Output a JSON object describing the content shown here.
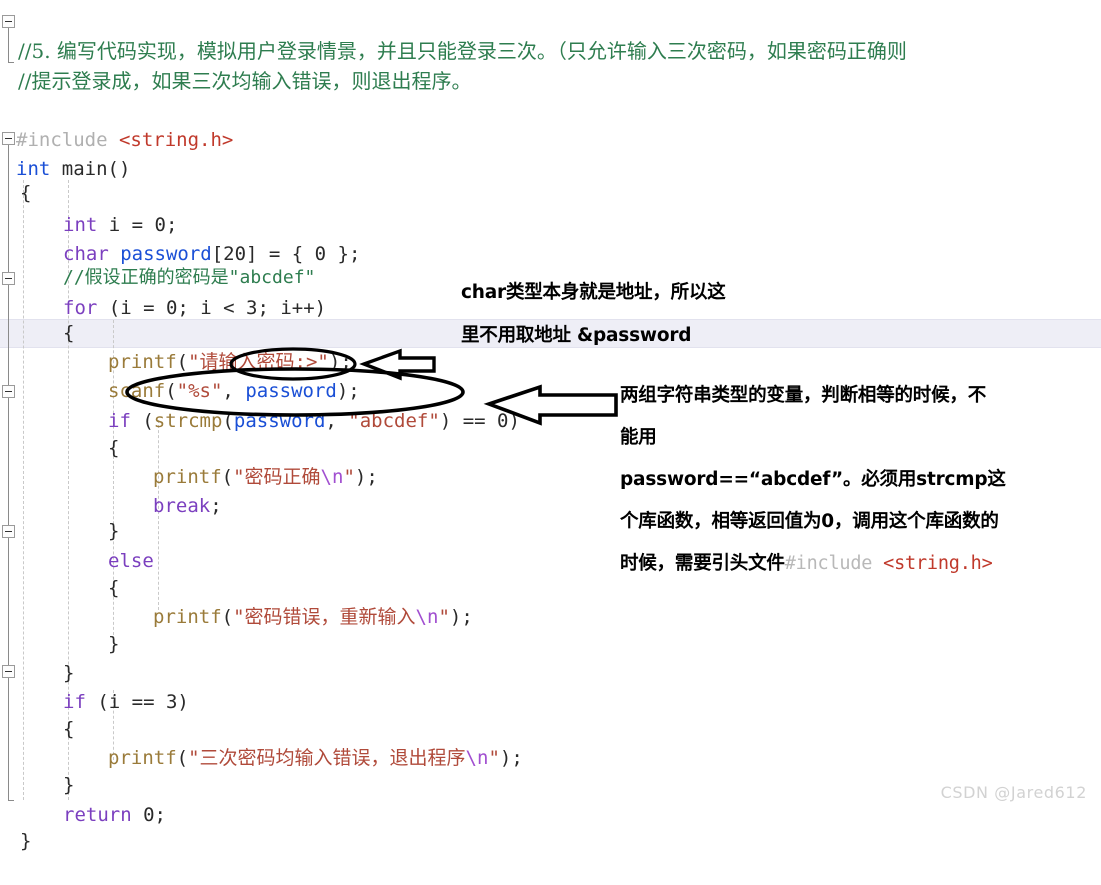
{
  "editor": {
    "top_comments": [
      "//5. 编写代码实现，模拟用户登录情景，并且只能登录三次。（只允许输入三次密码，如果密码正确则",
      "//提示登录成，如果三次均输入错误，则退出程序。"
    ],
    "lines": {
      "include_directive": "#include",
      "include_file": "<string.h>",
      "main_sig_kw": "int",
      "main_sig_name": "main",
      "main_sig_parens": "()",
      "brace_open": "{",
      "brace_close": "}",
      "decl_int_kw": "int",
      "decl_int_rest": " i = 0;",
      "decl_char_kw": "char",
      "decl_char_name": " password",
      "decl_char_rest": "[20] = { 0 };",
      "comment_pwd": "//假设正确的密码是\"abcdef\"",
      "for_kw": "for",
      "for_rest": " (i = 0; i < 3; i++)",
      "printf_name": "printf",
      "printf_prompt_str": "\"请输入密码:>\"",
      "scanf_name": "scanf",
      "scanf_fmt": "\"%s\"",
      "scanf_arg": "password",
      "if_kw": "if",
      "strcmp_name": "strcmp",
      "strcmp_arg1": "password",
      "strcmp_arg2": "\"abcdef\"",
      "strcmp_cmp": " == 0)",
      "printf_ok_str": "\"密码正确",
      "printf_ok_esc": "\\n",
      "break_kw": "break",
      "else_kw": "else",
      "printf_err_str": "\"密码错误，重新输入",
      "printf_err_esc": "\\n",
      "if2_kw": "if",
      "if2_rest": " (i == 3)",
      "printf_exit_str": "\"三次密码均输入错误，退出程序",
      "printf_exit_esc": "\\n",
      "return_kw": "return",
      "return_rest": " 0;",
      "semicolon": ";",
      "paren_open": "(",
      "paren_close": ")",
      "comma_sp": ", "
    }
  },
  "annotations": {
    "note1_line1": "char类型本身就是地址，所以这",
    "note1_line2": "里不用取地址 &password",
    "note2_line1": "两组字符串类型的变量，判断相等的时候，不",
    "note2_line2": "能用",
    "note2_line3": "password==“abcdef”。必须用strcmp这",
    "note2_line4": "个库函数，相等返回值为0，调用这个库函数的",
    "note2_line5_bold": "时候，需要引头文件",
    "note2_line5_code_pp": "#include",
    "note2_line5_code_file": "<string.h>"
  },
  "watermark": {
    "text": "CSDN @Jared612"
  },
  "colors": {
    "keyword": "#7b3fbf",
    "identifier_blue": "#1a4fd6",
    "function": "#9a7b3a",
    "string": "#b04a3a",
    "escape": "#a14fd0",
    "comment": "#2e7d4f",
    "preprocessor": "#b0b0b0",
    "include_file": "#c0392b",
    "highlight_band": "#eeeef6",
    "watermark": "#d2d2d2",
    "annotation": "#000000"
  }
}
